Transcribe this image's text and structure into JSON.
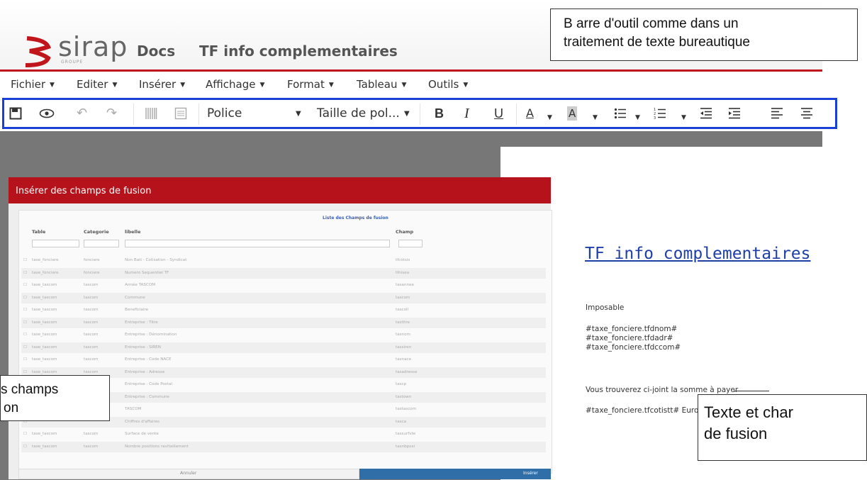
{
  "header": {
    "logo_text": "sirap",
    "logo_sub": "GROUPE",
    "app_name": "Docs",
    "document_title": "TF info complementaires"
  },
  "menubar": {
    "items": [
      "Fichier",
      "Editer",
      "Insérer",
      "Affichage",
      "Format",
      "Tableau",
      "Outils"
    ]
  },
  "toolbar": {
    "font_placeholder": "Police",
    "size_placeholder": "Taille de pol...",
    "icons": [
      "save-icon",
      "preview-eye-icon",
      "undo-icon",
      "redo-icon",
      "barcode-icon",
      "merge-field-icon",
      "bold-icon",
      "italic-icon",
      "underline-icon",
      "text-color-icon",
      "highlight-icon",
      "bullet-list-icon",
      "numbered-list-icon",
      "outdent-icon",
      "indent-icon",
      "align-left-icon",
      "align-center-icon"
    ],
    "border_color": "#1a3fd6"
  },
  "dialog": {
    "title": "Insérer des champs de fusion",
    "caption": "Liste des Champs de fusion",
    "columns": [
      "Table",
      "Categorie",
      "libelle",
      "Champ"
    ],
    "rows": [
      [
        "taxe_fonciere",
        "fonciere",
        "Non Bati - Cotisation - Syndicat",
        "tfcotsis"
      ],
      [
        "taxe_fonciere",
        "fonciere",
        "Numero Sequentiel TF",
        "tfnisea"
      ],
      [
        "taxe_tascom",
        "tascom",
        "Année TASCOM",
        "tasannee"
      ],
      [
        "taxe_tascom",
        "tascom",
        "Commune",
        "tascom"
      ],
      [
        "taxe_tascom",
        "tascom",
        "Beneficiaire",
        "tascoll"
      ],
      [
        "taxe_tascom",
        "tascom",
        "Entreprise : Titre",
        "tastitre"
      ],
      [
        "taxe_tascom",
        "tascom",
        "Entreprise : Dénomination",
        "tasnom"
      ],
      [
        "taxe_tascom",
        "tascom",
        "Entreprise : SIREN",
        "tassiren"
      ],
      [
        "taxe_tascom",
        "tascom",
        "Entreprise : Code NACE",
        "tasnace"
      ],
      [
        "taxe_tascom",
        "tascom",
        "Entreprise : Adresse",
        "tasadresse"
      ],
      [
        "",
        "",
        "Entreprise : Code Postal",
        "tascp"
      ],
      [
        "",
        "",
        "Entreprise : Commune",
        "tastown"
      ],
      [
        "",
        "",
        "TASCOM",
        "tastascom"
      ],
      [
        "",
        "",
        "Chiffres d'affaires",
        "tasca"
      ],
      [
        "taxe_tascom",
        "tascom",
        "Surface de vente",
        "tassurfvte"
      ],
      [
        "taxe_tascom",
        "tascom",
        "Nombre positions ravitaillement",
        "tasnbposi"
      ]
    ],
    "cancel_label": "Annuler",
    "insert_label": "Insérer",
    "header_color": "#b5121b",
    "insert_color": "#2f6ea6"
  },
  "document": {
    "heading": "TF info complementaires",
    "imposable": "Imposable",
    "fields": [
      "#taxe_fonciere.tfdnom#",
      "#taxe_fonciere.tfdadr#",
      "#taxe_fonciere.tfdccom#"
    ],
    "sentence": "Vous trouverez ci-joint la somme à payer",
    "amount_line": "#taxe_fonciere.tfcotistt# Euros",
    "heading_color": "#1f3fa8"
  },
  "callouts": {
    "toolbar_line1": "B arre d'outil comme dans un",
    "toolbar_line2": "traitement de texte bureautique",
    "fields_line1": "s champs",
    "fields_line2": "on",
    "merge_line1": "Texte et char",
    "merge_line2": "de fusion"
  }
}
